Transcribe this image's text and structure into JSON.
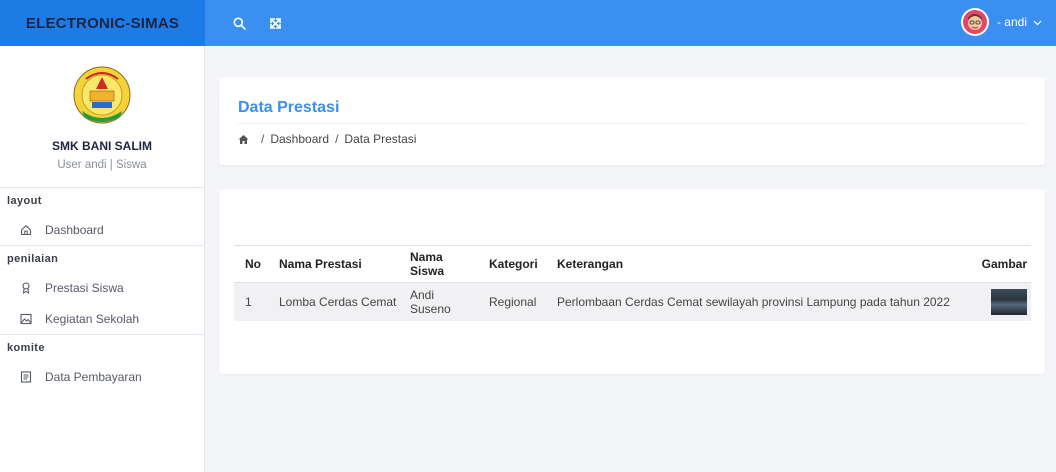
{
  "app": {
    "brand": "ELECTRONIC-SIMAS",
    "user_name": "- andi"
  },
  "icons": {
    "search": "search-icon",
    "fullscreen": "expand-icon",
    "dropdown": "chevron-down-icon",
    "home": "home-icon"
  },
  "colors": {
    "topbar": "#3a8ff0",
    "brand_bg": "#1d7be6",
    "accent": "#3a8ff0"
  },
  "sidebar": {
    "school_name": "SMK BANI SALIM",
    "user_role": "User andi | Siswa",
    "sections": [
      {
        "title": "layout",
        "items": [
          {
            "label": "Dashboard",
            "icon": "home-icon"
          }
        ]
      },
      {
        "title": "penilaian",
        "items": [
          {
            "label": "Prestasi Siswa",
            "icon": "award-icon"
          },
          {
            "label": "Kegiatan Sekolah",
            "icon": "image-icon"
          }
        ]
      },
      {
        "title": "komite",
        "items": [
          {
            "label": "Data Pembayaran",
            "icon": "document-icon"
          }
        ]
      }
    ]
  },
  "page": {
    "title": "Data Prestasi",
    "breadcrumb": [
      "Dashboard",
      "Data Prestasi"
    ]
  },
  "table": {
    "headers": [
      "No",
      "Nama Prestasi",
      "Nama Siswa",
      "Kategori",
      "Keterangan",
      "Gambar"
    ],
    "rows": [
      [
        "1",
        "Lomba Cerdas Cemat",
        "Andi Suseno",
        "Regional",
        "Perlombaan Cerdas Cemat sewilayah provinsi Lampung pada tahun 2022"
      ]
    ]
  }
}
